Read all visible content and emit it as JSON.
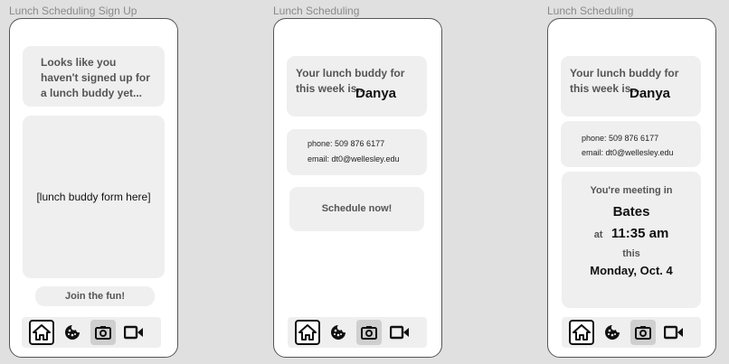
{
  "frames": [
    {
      "label": "Lunch Scheduling Sign Up"
    },
    {
      "label": "Lunch Scheduling"
    },
    {
      "label": "Lunch Scheduling"
    }
  ],
  "signup": {
    "prompt": "Looks like you haven't signed up for a lunch buddy yet...",
    "form_placeholder": "[lunch buddy form here]",
    "join_label": "Join the fun!"
  },
  "buddy": {
    "intro": "Your lunch buddy for this week is...",
    "name": "Danya",
    "phone": "phone: 509 876 6177",
    "email": "email: dt0@wellesley.edu",
    "schedule_label": "Schedule now!"
  },
  "meeting": {
    "intro": "You're meeting in",
    "place": "Bates",
    "at_label": "at",
    "time": "11:35 am",
    "this_label": "this",
    "date": "Monday, Oct. 4"
  },
  "nav": {
    "icons": [
      "home-icon",
      "cookie-icon",
      "camera-icon",
      "video-icon"
    ],
    "active": "home-icon"
  }
}
